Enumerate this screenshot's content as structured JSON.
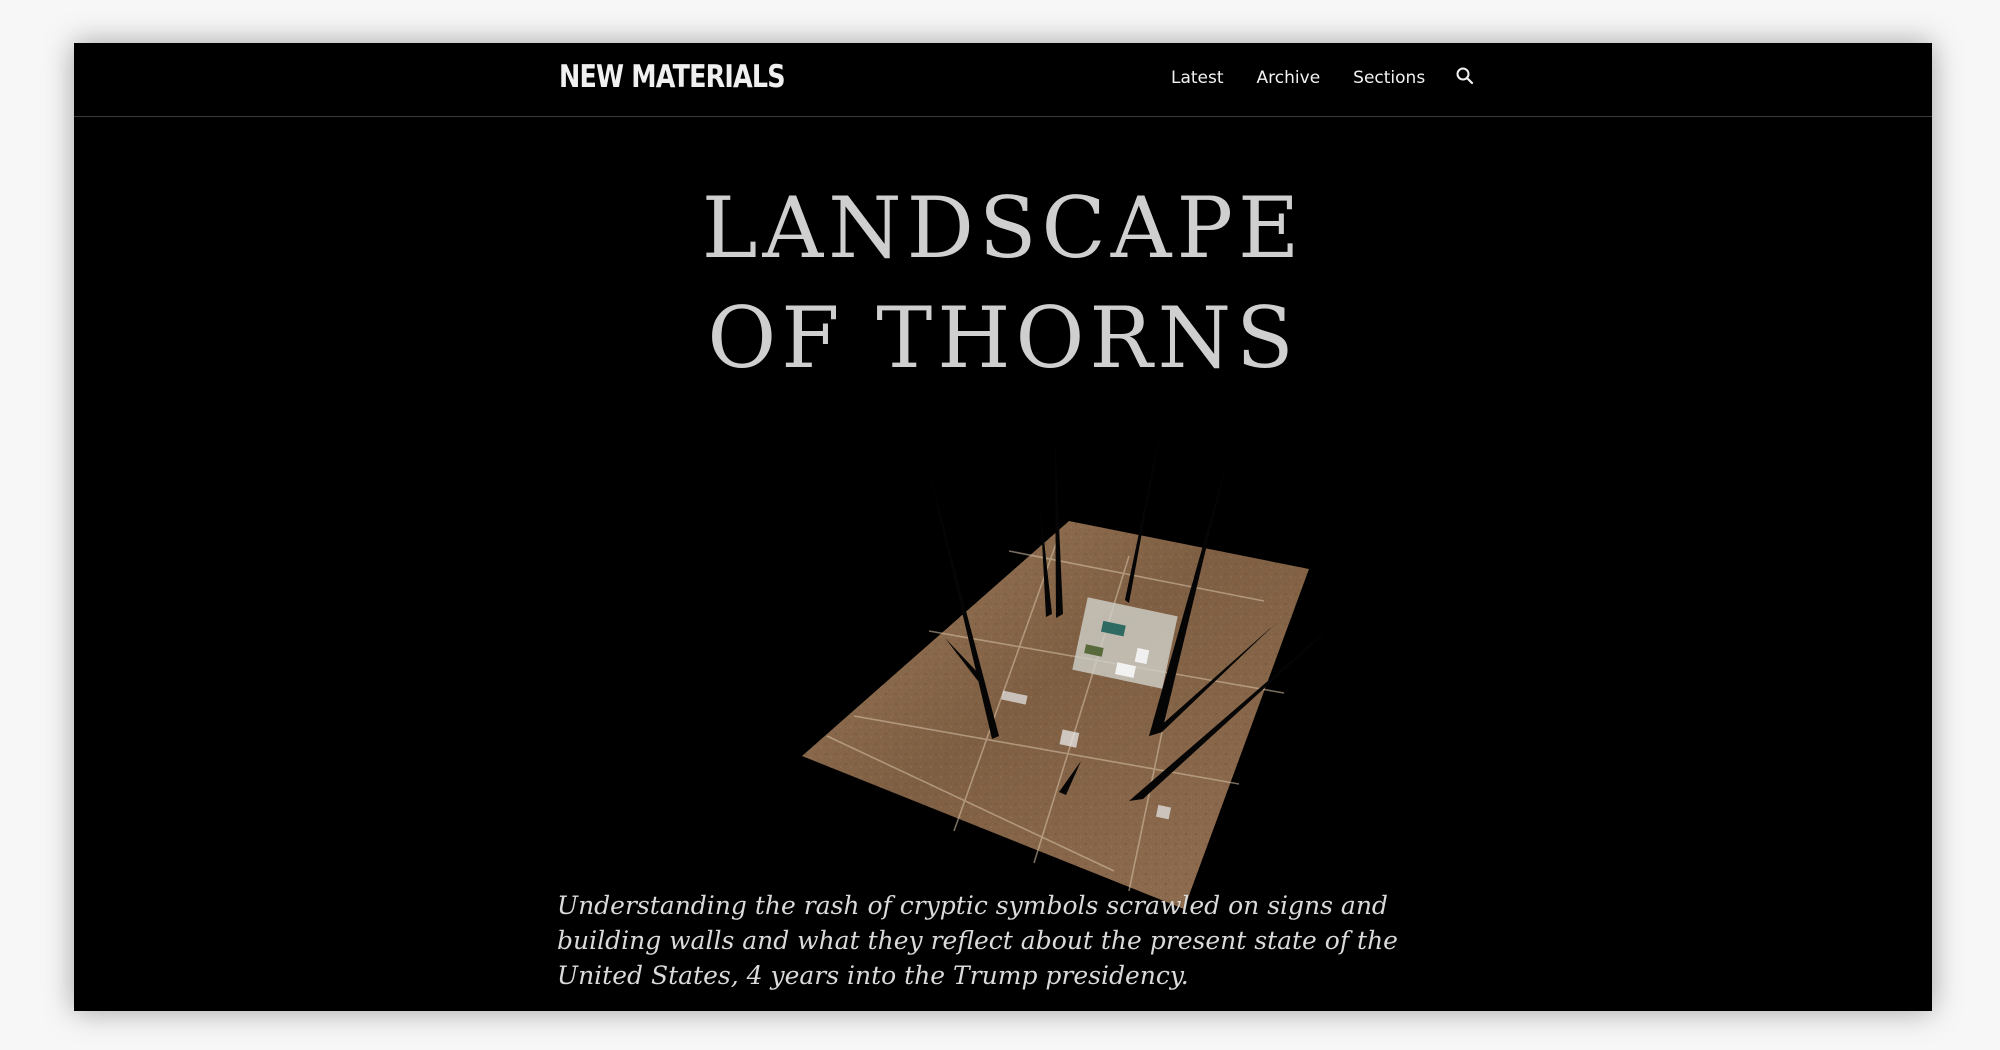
{
  "site": {
    "brand": "NEW MATERIALS"
  },
  "nav": {
    "items": [
      {
        "label": "Latest"
      },
      {
        "label": "Archive"
      },
      {
        "label": "Sections"
      }
    ],
    "search_icon": "search-icon"
  },
  "article": {
    "title_line_1": "LANDSCAPE",
    "title_line_2": "OF THORNS",
    "dek": "Understanding the rash of cryptic symbols scrawled on signs and building walls and what they reflect about the present state of the United States, 4 years into the Trump presidency."
  },
  "colors": {
    "background": "#000000",
    "text": "#f0f0f0",
    "title": "#cfcfcf",
    "terrain": "#8b6b4d"
  }
}
